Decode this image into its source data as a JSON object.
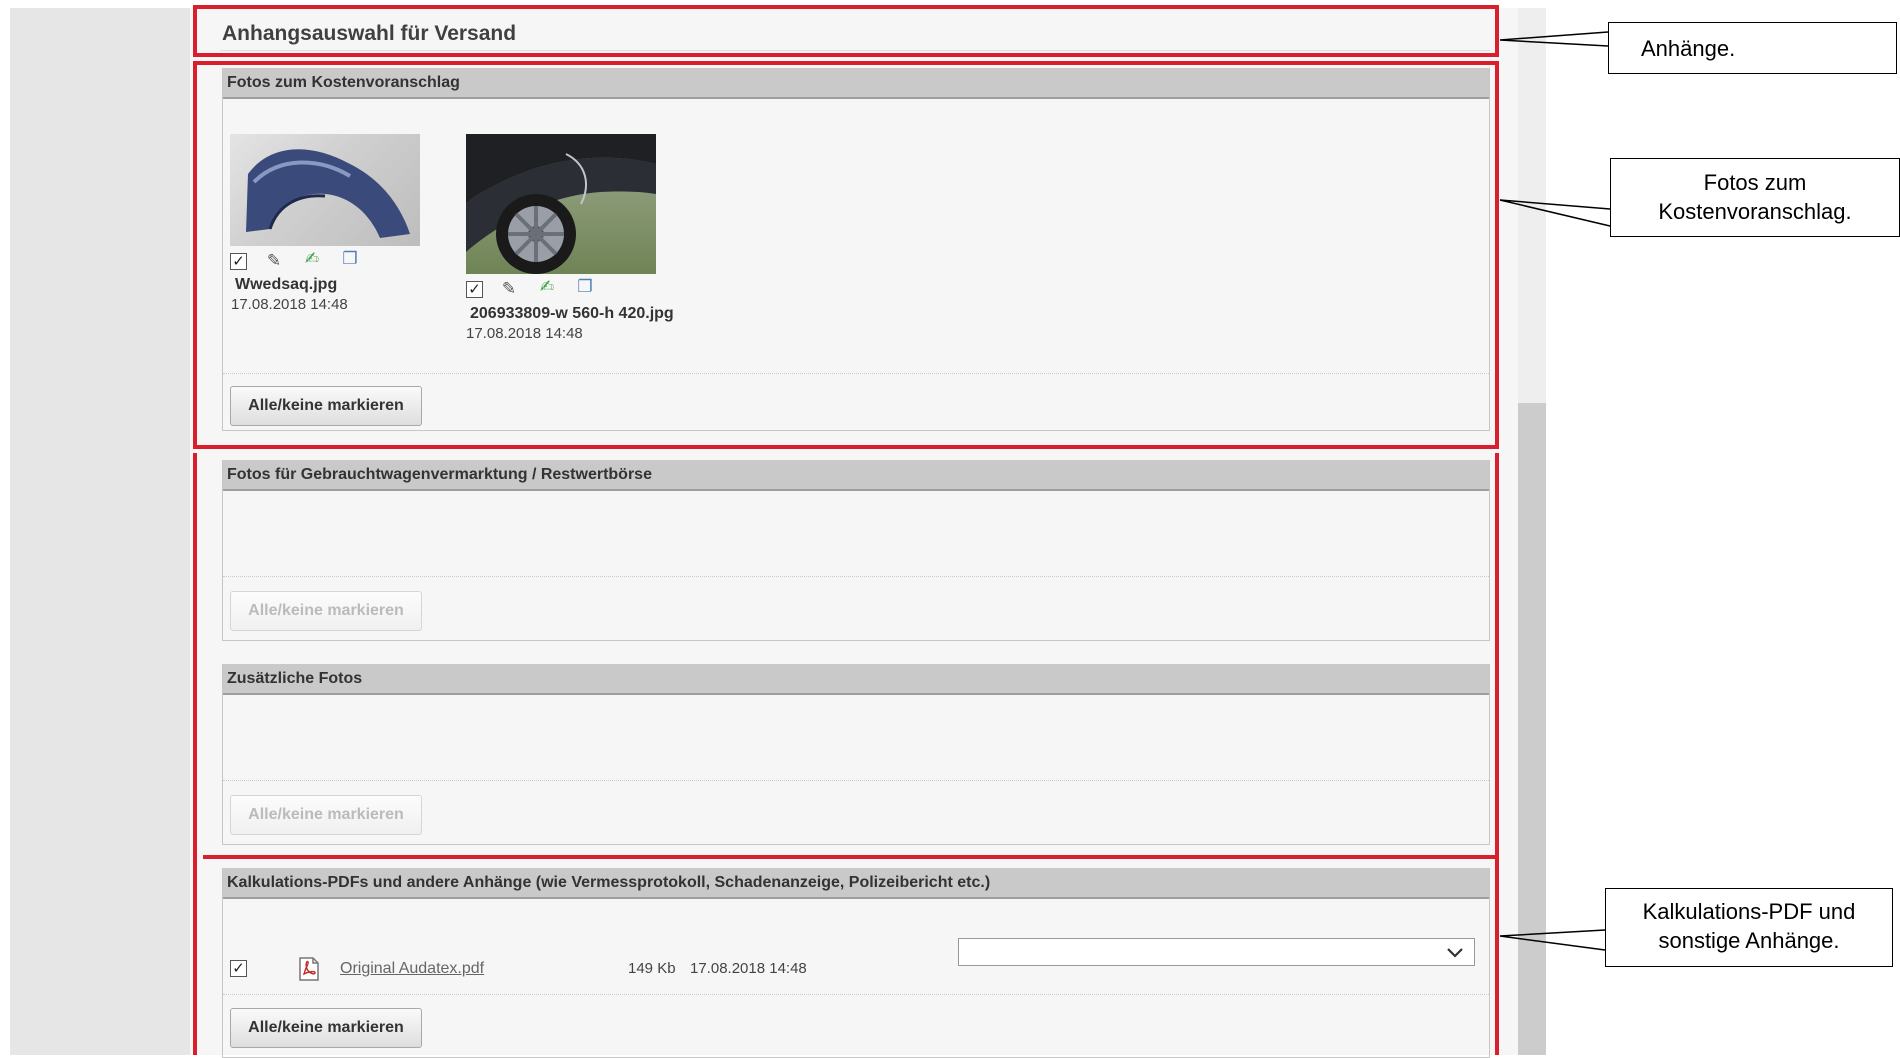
{
  "page": {
    "title": "Anhangsauswahl für Versand"
  },
  "sections": {
    "fotos_kv": {
      "header": "Fotos zum Kostenvoranschlag",
      "files": [
        {
          "name": "Wwedsaq.jpg",
          "date": "17.08.2018 14:48",
          "checked": true
        },
        {
          "name": "206933809-w 560-h 420.jpg",
          "date": "17.08.2018 14:48",
          "checked": true
        }
      ],
      "button": "Alle/keine markieren"
    },
    "fotos_gw": {
      "header": "Fotos für Gebrauchtwagenvermarktung / Restwertbörse",
      "button": "Alle/keine markieren"
    },
    "zusatz": {
      "header": "Zusätzliche Fotos",
      "button": "Alle/keine markieren"
    },
    "kalk": {
      "header": "Kalkulations-PDFs und andere Anhänge (wie Vermessprotokoll, Schadenanzeige, Polizeibericht etc.)",
      "file": {
        "name": "Original Audatex.pdf",
        "size": "149 Kb",
        "date": "17.08.2018 14:48",
        "checked": true,
        "select_value": ""
      },
      "button": "Alle/keine markieren"
    }
  },
  "callouts": {
    "anhaenge": "Anhänge.",
    "fotos_line1": "Fotos zum",
    "fotos_line2": "Kostenvoranschlag.",
    "kalk_line1": "Kalkulations-PDF und",
    "kalk_line2": "sonstige Anhänge."
  },
  "icons": {
    "checkbox": "checkbox-checked-icon",
    "edit": "edit-pencil-icon",
    "annotate": "annotate-note-icon",
    "copy": "copy-pages-icon",
    "pdf": "pdf-file-icon",
    "dropdown": "chevron-down-icon"
  },
  "colors": {
    "highlight": "#d91f2b",
    "section_header": "#c9c9c9",
    "panel": "#f6f6f6"
  }
}
